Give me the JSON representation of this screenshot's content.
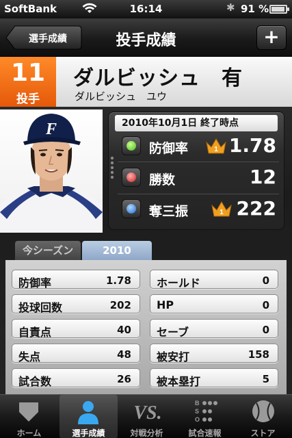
{
  "status_bar": {
    "carrier": "SoftBank",
    "time": "16:14",
    "battery": "91 %"
  },
  "nav": {
    "back_label": "選手成績",
    "title": "投手成績",
    "add_label": "+"
  },
  "player": {
    "number": "11",
    "position": "投手",
    "name": "ダルビッシュ　有",
    "kana": "ダルビッシュ　ユウ"
  },
  "summary": {
    "date": "2010年10月1日 終了時点",
    "stats": [
      {
        "label": "防御率",
        "value": "1.78",
        "rank": "1",
        "dot_color": "#6fd23a"
      },
      {
        "label": "勝数",
        "value": "12",
        "dot_color": "#e23a3a"
      },
      {
        "label": "奪三振",
        "value": "222",
        "rank": "1",
        "dot_color": "#3a8de2"
      }
    ]
  },
  "season_tabs": {
    "current": "今シーズン",
    "year": "2010"
  },
  "table": {
    "left": [
      {
        "label": "防御率",
        "value": "1.78"
      },
      {
        "label": "投球回数",
        "value": "202"
      },
      {
        "label": "自責点",
        "value": "40"
      },
      {
        "label": "失点",
        "value": "48"
      },
      {
        "label": "試合数",
        "value": "26"
      }
    ],
    "right": [
      {
        "label": "ホールド",
        "value": "0"
      },
      {
        "label": "HP",
        "value": "0"
      },
      {
        "label": "セーブ",
        "value": "0"
      },
      {
        "label": "被安打",
        "value": "158"
      },
      {
        "label": "被本塁打",
        "value": "5"
      }
    ]
  },
  "tab_bar": {
    "items": [
      {
        "label": "ホーム",
        "icon": "home-plate-icon"
      },
      {
        "label": "選手成績",
        "icon": "player-icon"
      },
      {
        "label": "対戦分析",
        "icon": "vs-icon"
      },
      {
        "label": "試合速報",
        "icon": "scoreboard-icon"
      },
      {
        "label": "ストア",
        "icon": "baseball-icon"
      }
    ],
    "active_index": 1
  },
  "colors": {
    "accent_orange": "#f47a1f",
    "tab_active": "#9fb6d3"
  }
}
